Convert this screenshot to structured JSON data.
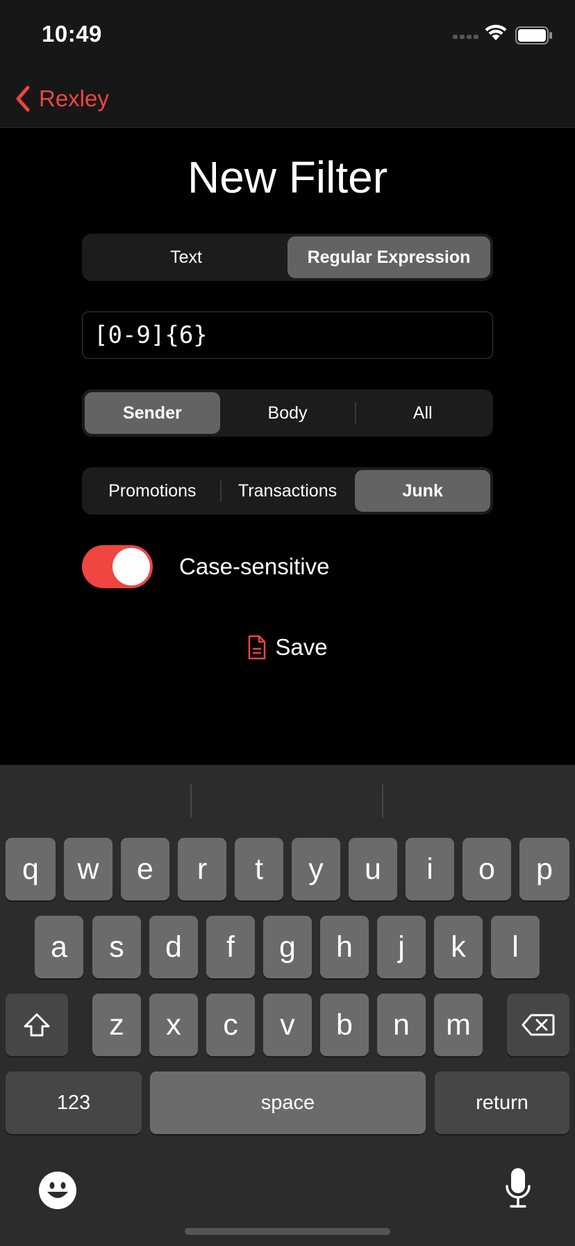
{
  "status_bar": {
    "time": "10:49"
  },
  "nav": {
    "back_label": "Rexley"
  },
  "page": {
    "title": "New Filter"
  },
  "filter_type": {
    "options": [
      "Text",
      "Regular Expression"
    ],
    "selected": "Regular Expression"
  },
  "pattern": {
    "value": "[0-9]{6}"
  },
  "scope": {
    "options": [
      "Sender",
      "Body",
      "All"
    ],
    "selected": "Sender"
  },
  "category": {
    "options": [
      "Promotions",
      "Transactions",
      "Junk"
    ],
    "selected": "Junk"
  },
  "case_sensitive": {
    "label": "Case-sensitive",
    "enabled": true
  },
  "save": {
    "label": "Save"
  },
  "keyboard": {
    "row1": [
      "q",
      "w",
      "e",
      "r",
      "t",
      "y",
      "u",
      "i",
      "o",
      "p"
    ],
    "row2": [
      "a",
      "s",
      "d",
      "f",
      "g",
      "h",
      "j",
      "k",
      "l"
    ],
    "row3": [
      "z",
      "x",
      "c",
      "v",
      "b",
      "n",
      "m"
    ],
    "numbers_label": "123",
    "space_label": "space",
    "return_label": "return"
  },
  "colors": {
    "accent": "#ee4540",
    "selected_segment": "#636366",
    "keyboard_bg": "#2c2c2e"
  }
}
